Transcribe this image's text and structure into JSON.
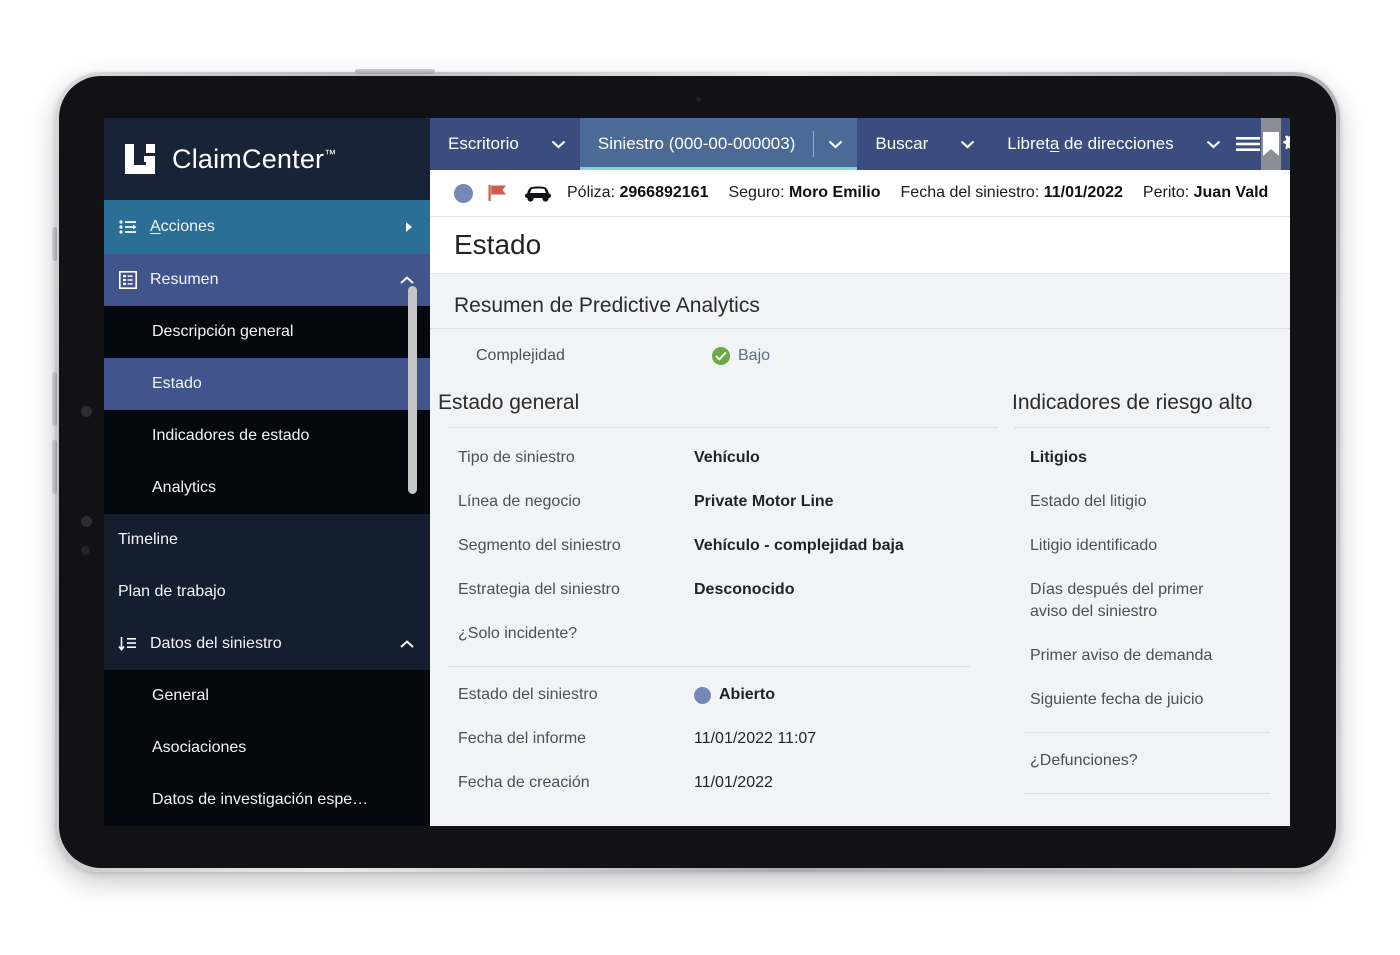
{
  "brand": {
    "name": "ClaimCenter",
    "trademark": "™",
    "logo_icon": "claimcenter-logo-icon"
  },
  "sidebar": {
    "actions": {
      "label": "Acciones",
      "icon": "actions-list-icon",
      "caret": "▶"
    },
    "groups": [
      {
        "label": "Resumen",
        "icon": "summary-grid-icon",
        "caret": "⌃",
        "items": [
          {
            "label": "Descripción general",
            "selected": false
          },
          {
            "label": "Estado",
            "selected": true
          },
          {
            "label": "Indicadores de estado",
            "selected": false
          },
          {
            "label": "Analytics",
            "selected": false
          }
        ]
      }
    ],
    "timeline": {
      "label": "Timeline"
    },
    "workplan": {
      "label": "Plan de trabajo"
    },
    "claim_data": {
      "label": "Datos del siniestro",
      "icon": "sort-list-icon",
      "caret": "⌃",
      "items": [
        {
          "label": "General"
        },
        {
          "label": "Asociaciones"
        },
        {
          "label": "Datos de investigación espe…"
        }
      ]
    }
  },
  "topbar": {
    "items": [
      {
        "label": "Escritorio",
        "active": false,
        "caret": "⌄"
      },
      {
        "label": "Siniestro (000-00-000003)",
        "active": true,
        "caret": "⌄"
      },
      {
        "label": "Buscar",
        "active": false,
        "caret": "⌄"
      },
      {
        "label": "Libreta de direcciones",
        "active": false,
        "caret": "⌄"
      }
    ],
    "icons": [
      {
        "name": "hamburger-menu-icon",
        "highlighted": false
      },
      {
        "name": "bookmark-icon",
        "highlighted": true
      },
      {
        "name": "gear-icon",
        "highlighted": false
      }
    ]
  },
  "claimbar": {
    "status_icon": "status-circle-icon",
    "flag_icon": "red-flag-icon",
    "vehicle_icon": "car-icon",
    "fields": [
      {
        "key": "Póliza:",
        "value": "2966892161"
      },
      {
        "key": "Seguro:",
        "value": "Moro Emilio"
      },
      {
        "key": "Fecha del siniestro:",
        "value": "11/01/2022"
      },
      {
        "key": "Perito:",
        "value": "Juan Vald"
      }
    ]
  },
  "page": {
    "title": "Estado"
  },
  "predictive": {
    "heading": "Resumen de Predictive Analytics",
    "complexity_label": "Complejidad",
    "complexity_value": "Bajo",
    "complexity_icon": "green-check-icon"
  },
  "general_status": {
    "heading": "Estado general",
    "fields": [
      {
        "label": "Tipo de siniestro",
        "value": "Vehículo"
      },
      {
        "label": "Línea de negocio",
        "value": "Private Motor Line"
      },
      {
        "label": "Segmento del siniestro",
        "value": "Vehículo - complejidad baja"
      },
      {
        "label": "Estrategia del siniestro",
        "value": "Desconocido"
      },
      {
        "label": "¿Solo incidente?",
        "value": ""
      }
    ],
    "fields2": [
      {
        "label": "Estado del siniestro",
        "value": "Abierto",
        "dot": true
      },
      {
        "label": "Fecha del informe",
        "value": "11/01/2022 11:07"
      },
      {
        "label": "Fecha de creación",
        "value": "11/01/2022"
      }
    ]
  },
  "risk_indicators": {
    "heading": "Indicadores de riesgo alto",
    "items": [
      {
        "label": "Litigios",
        "bold": true
      },
      {
        "label": "Estado del litigio",
        "bold": false
      },
      {
        "label": "Litigio identificado",
        "bold": false
      },
      {
        "label": "Días después del primer aviso del siniestro",
        "bold": false
      },
      {
        "label": "Primer aviso de demanda",
        "bold": false
      },
      {
        "label": "Siguiente fecha de juicio",
        "bold": false
      }
    ],
    "items2": [
      {
        "label": "¿Defunciones?",
        "bold": false
      }
    ]
  },
  "colors": {
    "topbar_bg": "#3b4c7e",
    "tab_active_bg": "#4b6a96",
    "tab_underline": "#7fd6d6",
    "sidebar_bg": "#0a0d14",
    "sidebar_brand_bg": "#182337",
    "actions_bg": "#2b6e96",
    "group_bg": "#41558c",
    "content_bg": "#f2f3f5",
    "status_blue": "#7588b8",
    "flag_red": "#d4604f",
    "check_green": "#6aab46"
  }
}
